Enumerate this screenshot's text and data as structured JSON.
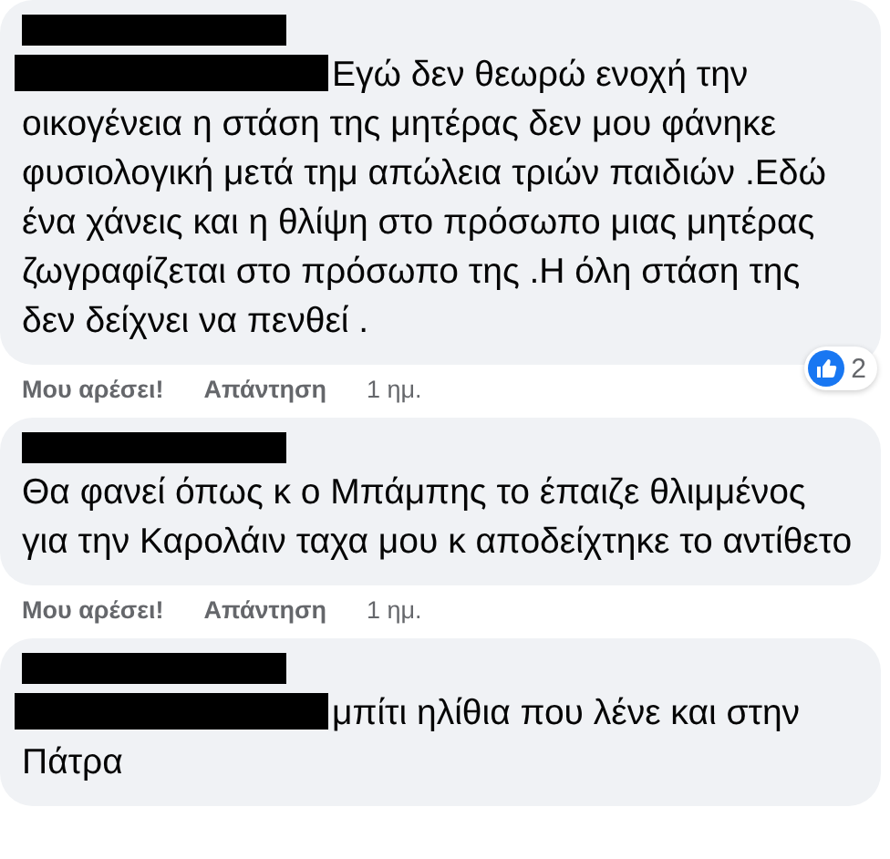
{
  "comments": [
    {
      "name_redacted": true,
      "text_start_redacted": true,
      "text": "Εγώ δεν θεωρώ ενοχή την οικογένεια η στάση της μητέρας δεν μου φάνηκε φυσιολογική μετά τημ απώλεια τριών παιδιών .Εδώ ένα χάνεις και η θλίψη στο πρόσωπο μιας μητέρας ζωγραφίζεται στο πρόσωπο της .Η όλη στάση της δεν δείχνει να πενθεί .",
      "reactions": "2",
      "actions": {
        "like": "Μου αρέσει!",
        "reply": "Απάντηση",
        "time": "1 ημ."
      }
    },
    {
      "name_redacted": true,
      "text": "Θα φανεί όπως κ ο Μπάμπης το έπαιζε θλιμμένος για την Καρολάιν ταχα μου κ αποδείχτηκε το αντίθετο",
      "actions": {
        "like": "Μου αρέσει!",
        "reply": "Απάντηση",
        "time": "1 ημ."
      }
    },
    {
      "name_redacted": true,
      "text_start_redacted": true,
      "text": "μπίτι ηλίθια που λένε και στην Πάτρα"
    }
  ]
}
